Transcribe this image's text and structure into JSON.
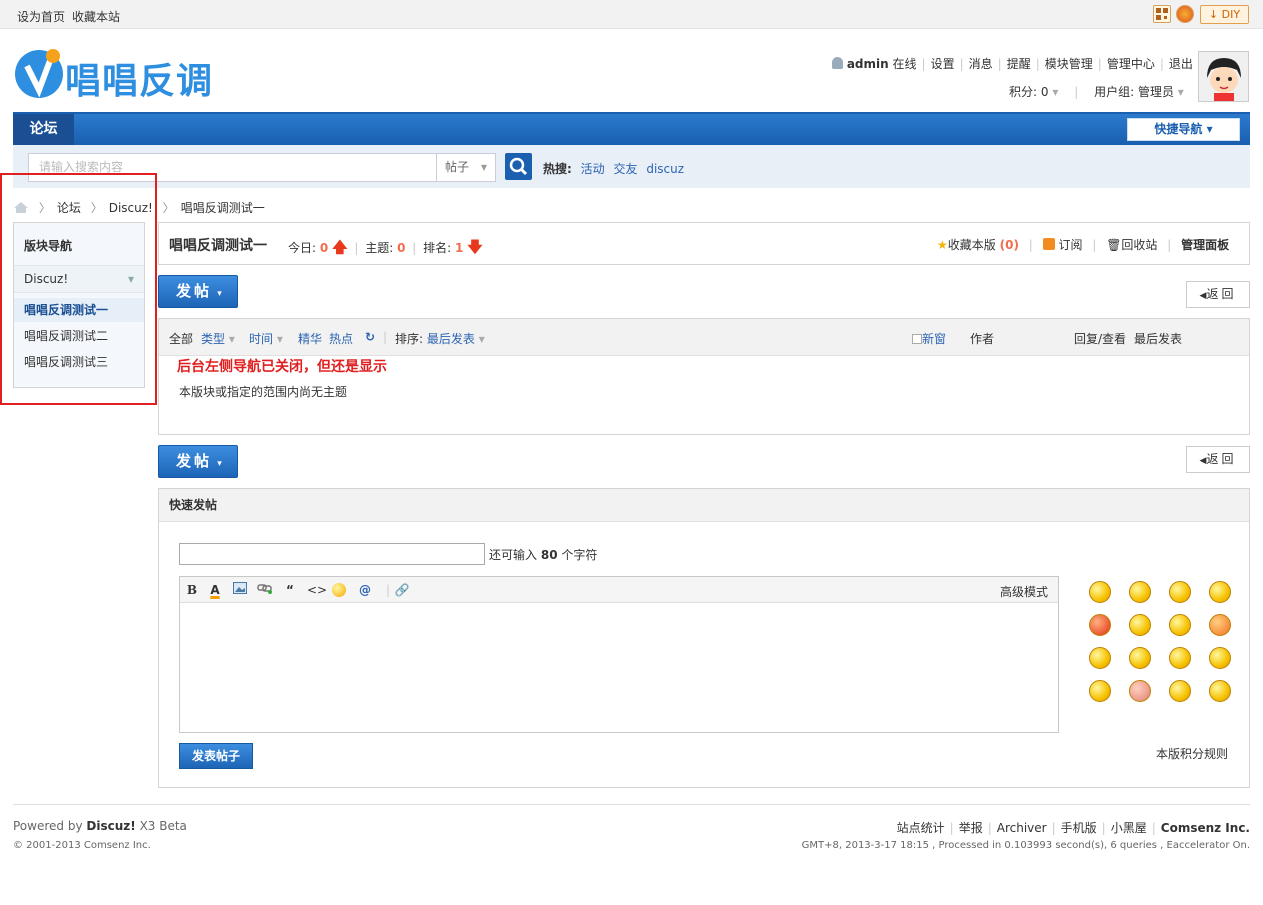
{
  "topbar": {
    "set_home": "设为首页",
    "bookmark": "收藏本站",
    "diy": "DIY"
  },
  "header": {
    "logo_text": "唱唱反调",
    "user": {
      "name": "admin",
      "status": "在线"
    },
    "links": [
      "设置",
      "消息",
      "提醒",
      "模块管理",
      "管理中心",
      "退出"
    ],
    "points_label": "积分:",
    "points_value": "0",
    "group_label": "用户组:",
    "group_value": "管理员"
  },
  "nav": {
    "forum": "论坛",
    "quick_nav": "快捷导航"
  },
  "search": {
    "placeholder": "请输入搜索内容",
    "type": "帖子",
    "hot_label": "热搜:",
    "hot_terms": [
      "活动",
      "交友",
      "discuz"
    ]
  },
  "breadcrumb": {
    "items": [
      "论坛",
      "Discuz!",
      "唱唱反调测试一"
    ]
  },
  "sidebar": {
    "title": "版块导航",
    "category": "Discuz!",
    "items": [
      "唱唱反调测试一",
      "唱唱反调测试二",
      "唱唱反调测试三"
    ]
  },
  "forum": {
    "title": "唱唱反调测试一",
    "today_label": "今日:",
    "today_value": "0",
    "threads_label": "主题:",
    "threads_value": "0",
    "rank_label": "排名:",
    "rank_value": "1",
    "favorite_label": "收藏本版",
    "favorite_count": "(0)",
    "subscribe": "订阅",
    "recycle": "回收站",
    "admin_panel": "管理面板"
  },
  "buttons": {
    "post": "发帖",
    "back": "返回"
  },
  "threadlist": {
    "all": "全部",
    "type": "类型",
    "time": "时间",
    "digest": "精华",
    "hot": "热点",
    "sort_label": "排序:",
    "sort_value": "最后发表",
    "new_window": "新窗",
    "author": "作者",
    "replies_views": "回复/查看",
    "last_post": "最后发表",
    "notice": "后台左侧导航已关闭，但还是显示",
    "empty": "本版块或指定的范围内尚无主题"
  },
  "quickpost": {
    "title": "快速发帖",
    "remain_prefix": "还可输入",
    "remain_count": "80",
    "remain_suffix": "个字符",
    "advanced": "高级模式",
    "submit": "发表帖子",
    "rules": "本版积分规则"
  },
  "footer": {
    "powered_prefix": "Powered by",
    "powered_brand": "Discuz!",
    "powered_ver": "X3 Beta",
    "copyright": "© 2001-2013 Comsenz Inc.",
    "links": [
      "站点统计",
      "举报",
      "Archiver",
      "手机版",
      "小黑屋"
    ],
    "company": "Comsenz Inc.",
    "info": "GMT+8, 2013-3-17 18:15 , Processed in 0.103993 second(s), 6 queries , Eaccelerator On."
  },
  "colors": {
    "brand_blue": "#1a5fb0",
    "accent_red": "#e02020",
    "stat_orange": "#f26c4f"
  }
}
